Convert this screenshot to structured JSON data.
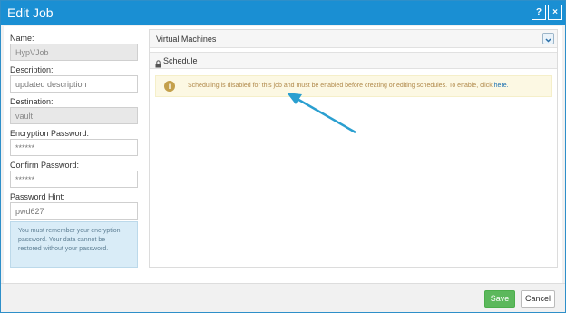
{
  "window": {
    "title": "Edit Job",
    "help_label": "?",
    "close_label": "×"
  },
  "form": {
    "name_label": "Name:",
    "name_value": "HypVJob",
    "description_label": "Description:",
    "description_placeholder": "updated description",
    "destination_label": "Destination:",
    "destination_value": "vault",
    "encryption_label": "Encryption Password:",
    "encryption_value": "******",
    "confirm_label": "Confirm Password:",
    "confirm_value": "******",
    "hint_label": "Password Hint:",
    "hint_value": "pwd627",
    "note": "You must remember your encryption password. Your data cannot be restored without your password."
  },
  "panels": {
    "vm_label": "Virtual Machines",
    "schedule_label": "Schedule",
    "alert_text": "Scheduling is disabled for this job and must be enabled before creating or editing schedules. To enable, click",
    "alert_link": "here."
  },
  "footer": {
    "save_label": "Save",
    "cancel_label": "Cancel"
  },
  "colors": {
    "titlebar": "#1a8fd3",
    "save": "#5cb85c",
    "alert_bg": "#fcf8e3",
    "annotation_arrow": "#2a9fd0"
  },
  "icons": [
    "help-icon",
    "close-icon",
    "chevron-down-icon",
    "lock-icon",
    "info-icon",
    "annotation-arrow"
  ]
}
